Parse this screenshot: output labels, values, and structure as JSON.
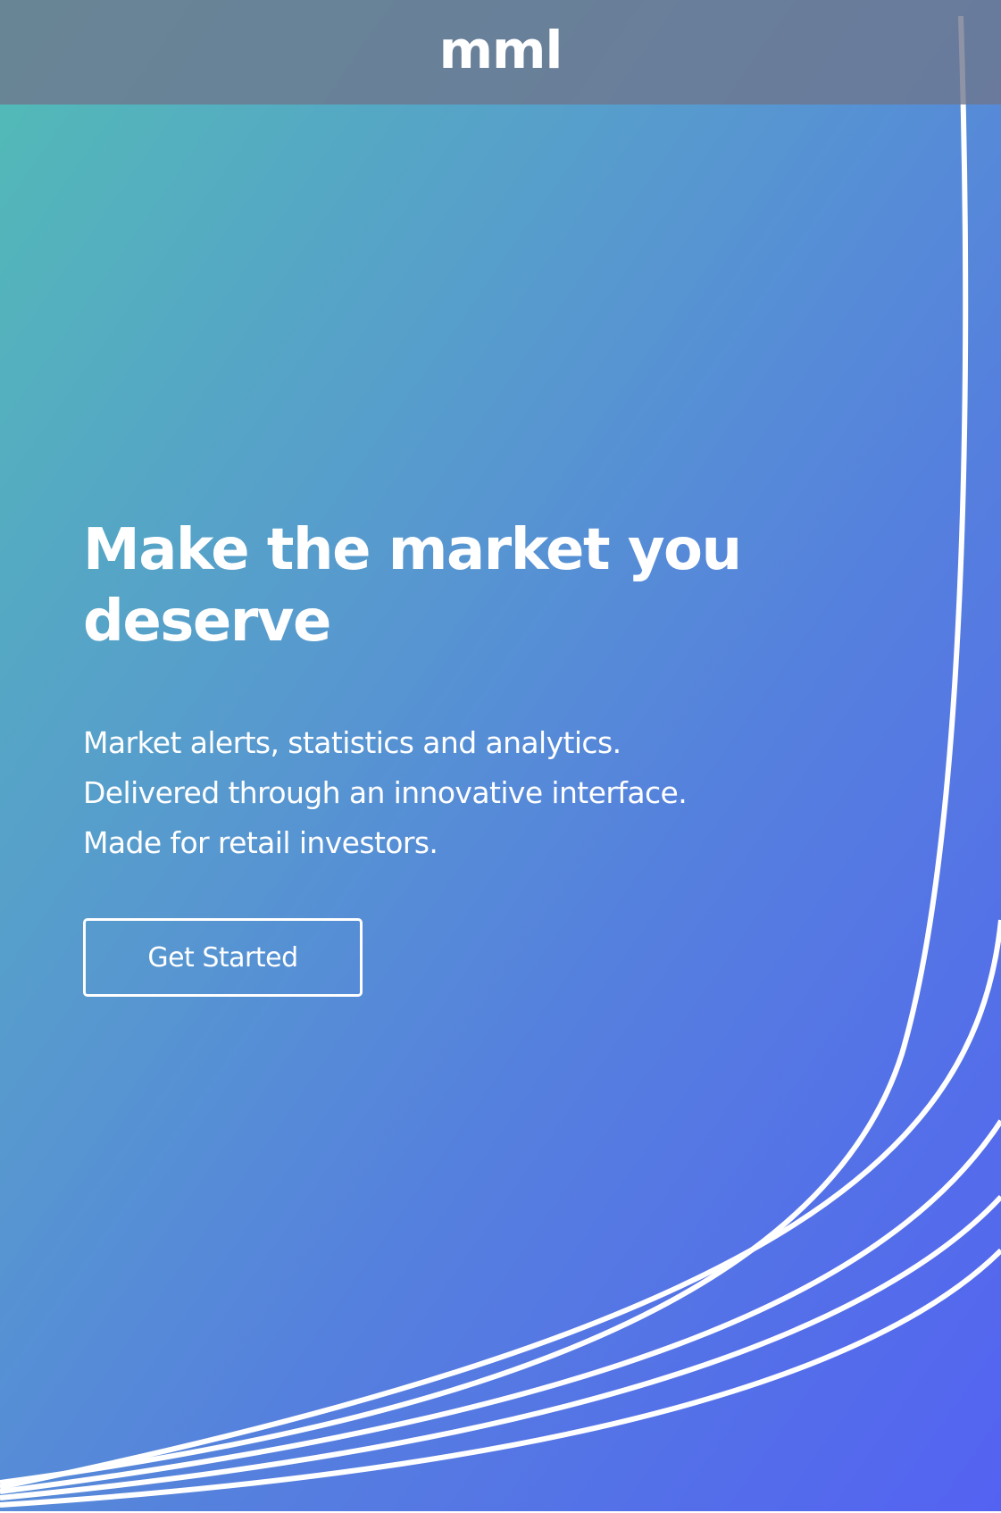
{
  "navbar": {
    "logo": "mml"
  },
  "hero": {
    "headline": "Make the market you deserve",
    "subtext_lines": [
      "Market alerts, statistics and analytics.",
      "Delivered through an innovative interface.",
      "Made for retail investors."
    ],
    "cta_label": "Get Started"
  },
  "colors": {
    "gradient_start": "#52bcb5",
    "gradient_mid": "#5799cf",
    "gradient_end": "#5462f2",
    "navbar_overlay": "#6e768c",
    "text": "#ffffff"
  }
}
